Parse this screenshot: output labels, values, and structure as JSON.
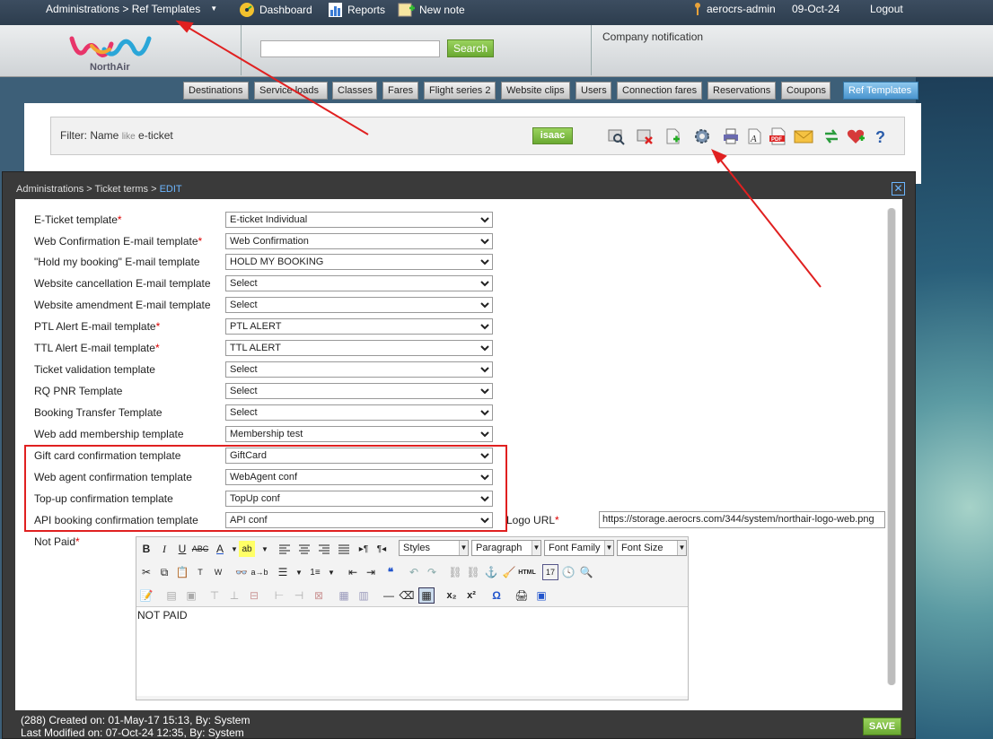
{
  "topbar": {
    "breadcrumb": "Administrations > Ref Templates",
    "dashboard": "Dashboard",
    "reports": "Reports",
    "new_note": "New note",
    "user": "aerocrs-admin",
    "date": "09-Oct-24",
    "logout": "Logout"
  },
  "header": {
    "logo_text": "NorthAir",
    "search_placeholder": "",
    "search_button": "Search",
    "company_notification": "Company notification"
  },
  "nav_tabs": [
    "Destinations",
    "Service loads",
    "Classes",
    "Fares",
    "Flight series 2",
    "Website clips",
    "Users",
    "Connection fares",
    "Reservations",
    "Coupons",
    "Ref Templates"
  ],
  "filter": {
    "label": "Filter: Name",
    "operator": "like",
    "value": "e-ticket",
    "user_button": "isaac"
  },
  "toolbar_icons": [
    "search-icon",
    "clear-filter-icon",
    "add-icon",
    "settings-icon",
    "print-icon",
    "font-icon",
    "pdf-icon",
    "email-icon",
    "refresh-icon",
    "favorite-icon",
    "help-icon"
  ],
  "modal": {
    "breadcrumb_path": "Administrations > Ticket terms >",
    "breadcrumb_current": "EDIT",
    "close": "✕"
  },
  "form": {
    "rows": [
      {
        "label": "E-Ticket template",
        "required": "*",
        "value": "E-ticket Individual"
      },
      {
        "label": "Web Confirmation E-mail template",
        "required": "*",
        "value": "Web Confirmation"
      },
      {
        "label": "\"Hold my booking\" E-mail template",
        "required": "",
        "value": "HOLD MY BOOKING"
      },
      {
        "label": "Website cancellation E-mail template",
        "required": "",
        "value": "Select"
      },
      {
        "label": "Website amendment E-mail template",
        "required": "",
        "value": "Select"
      },
      {
        "label": "PTL Alert E-mail template",
        "required": "*",
        "value": "PTL ALERT"
      },
      {
        "label": "TTL Alert E-mail template",
        "required": "*",
        "value": "TTL ALERT"
      },
      {
        "label": "Ticket validation template",
        "required": "",
        "value": "Select"
      },
      {
        "label": "RQ PNR Template",
        "required": "",
        "value": "Select"
      },
      {
        "label": "Booking Transfer Template",
        "required": "",
        "value": "Select"
      },
      {
        "label": "Web add membership template",
        "required": "",
        "value": "Membership test"
      },
      {
        "label": "Gift card confirmation template",
        "required": "",
        "value": "GiftCard"
      },
      {
        "label": "Web agent confirmation template",
        "required": "",
        "value": "WebAgent conf"
      },
      {
        "label": "Top-up confirmation template",
        "required": "",
        "value": "TopUp conf"
      },
      {
        "label": "API booking confirmation template",
        "required": "",
        "value": "API conf"
      }
    ],
    "logo_url_label": "Logo URL",
    "logo_url_required": "*",
    "logo_url_value": "https://storage.aerocrs.com/344/system/northair-logo-web.png",
    "not_paid_label": "Not Paid",
    "not_paid_required": "*"
  },
  "editor": {
    "styles": "Styles",
    "paragraph": "Paragraph",
    "font_family": "Font Family",
    "font_size": "Font Size",
    "content": "NOT PAID"
  },
  "footer": {
    "created": "(288) Created on: 01-May-17 15:13, By: System",
    "modified": "Last Modified on: 07-Oct-24 12:35, By: System",
    "save": "SAVE"
  },
  "colors": {
    "accent_green": "#6aa932",
    "active_tab": "#4a95cf",
    "highlight_red": "#e02020",
    "required_red": "#dd0000"
  }
}
